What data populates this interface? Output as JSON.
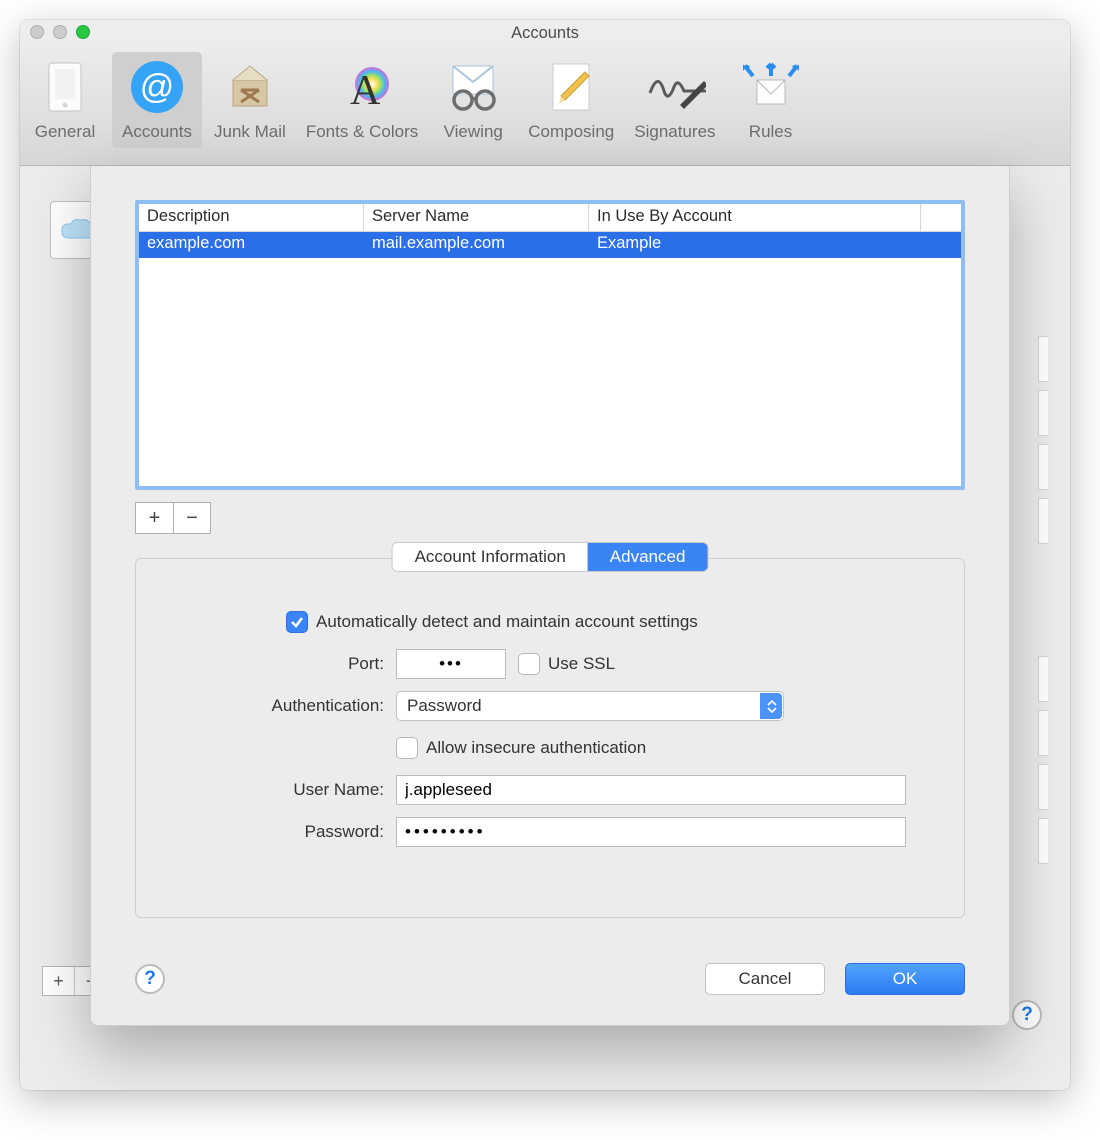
{
  "window": {
    "title": "Accounts"
  },
  "toolbar": {
    "items": [
      {
        "label": "General"
      },
      {
        "label": "Accounts"
      },
      {
        "label": "Junk Mail"
      },
      {
        "label": "Fonts & Colors"
      },
      {
        "label": "Viewing"
      },
      {
        "label": "Composing"
      },
      {
        "label": "Signatures"
      },
      {
        "label": "Rules"
      }
    ],
    "selected_index": 1
  },
  "server_table": {
    "columns": {
      "description": "Description",
      "server": "Server Name",
      "account": "In Use By Account"
    },
    "rows": [
      {
        "description": "example.com",
        "server": "mail.example.com",
        "account": "Example",
        "selected": true
      }
    ],
    "add_label": "+",
    "remove_label": "−"
  },
  "tabs": {
    "info": "Account Information",
    "advanced": "Advanced",
    "active": "advanced"
  },
  "form": {
    "auto_detect": {
      "label": "Automatically detect and maintain account settings",
      "checked": true
    },
    "port": {
      "label": "Port:",
      "value": "•••"
    },
    "use_ssl": {
      "label": "Use SSL",
      "checked": false
    },
    "authentication": {
      "label": "Authentication:",
      "value": "Password"
    },
    "allow_insecure": {
      "label": "Allow insecure authentication",
      "checked": false
    },
    "username": {
      "label": "User Name:",
      "value": "j.appleseed"
    },
    "password": {
      "label": "Password:",
      "value": "•••••••••"
    }
  },
  "buttons": {
    "cancel": "Cancel",
    "ok": "OK",
    "help": "?"
  },
  "bg": {
    "add": "+",
    "remove": "−",
    "help": "?"
  }
}
